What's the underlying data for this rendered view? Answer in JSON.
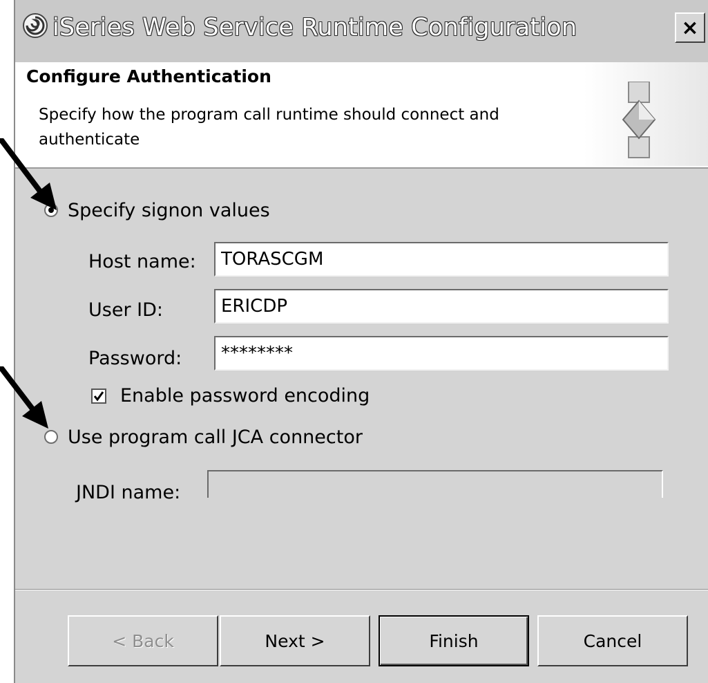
{
  "window": {
    "title": "iSeries Web Service Runtime Configuration",
    "close_label": "×"
  },
  "header": {
    "title": "Configure Authentication",
    "description": "Specify how the program call runtime should connect and authenticate"
  },
  "auth": {
    "option_signon_label": "Specify signon values",
    "option_signon_selected": true,
    "host_name_label": "Host name:",
    "host_name_value": "TORASCGM",
    "user_id_label": "User ID:",
    "user_id_value": "ERICDP",
    "password_label": "Password:",
    "password_value": "********",
    "encoding_label": "Enable password encoding",
    "encoding_checked": true,
    "option_jca_label": "Use program call JCA connector",
    "option_jca_selected": false,
    "jndi_label": "JNDI name:",
    "jndi_value": ""
  },
  "buttons": {
    "back": "< Back",
    "next": "Next >",
    "finish": "Finish",
    "cancel": "Cancel"
  },
  "colors": {
    "dialog_background": "#d4d4d4",
    "header_background": "#ffffff",
    "title_text": "#ffffff"
  }
}
